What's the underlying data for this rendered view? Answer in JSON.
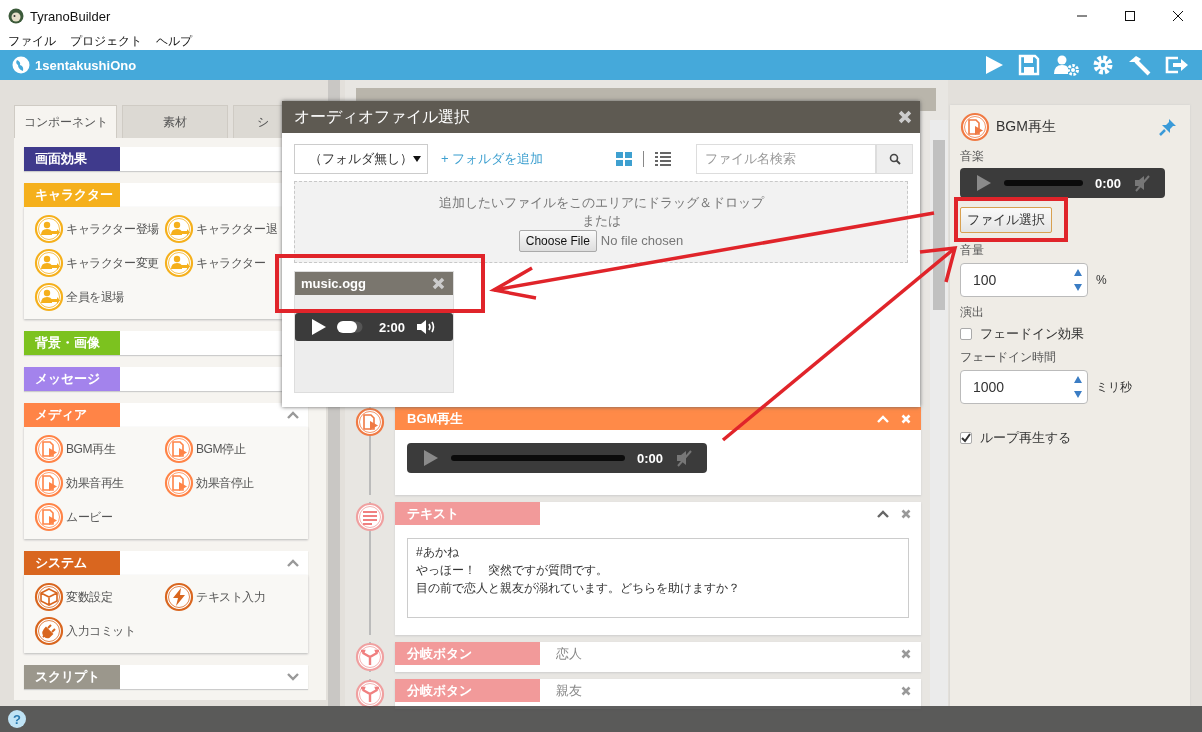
{
  "window": {
    "title": "TyranoBuilder"
  },
  "menu": [
    "ファイル",
    "プロジェクト",
    "ヘルプ"
  ],
  "toolbar": {
    "project": "1sentakushiOno"
  },
  "library": {
    "tabs": [
      {
        "label": "コンポーネント",
        "selected": true
      },
      {
        "label": "素材",
        "selected": false
      },
      {
        "label": "シ",
        "selected": false
      }
    ],
    "categories": [
      {
        "label": "画面効果",
        "color": "#3f3a8c"
      },
      {
        "kind": "character",
        "label": "キャラクター",
        "color": "#f5b01c",
        "items": [
          "キャラクター登場",
          "キャラクター退",
          "キャラクター変更",
          "キャラクター",
          "全員を退場"
        ]
      },
      {
        "label": "背景・画像",
        "color": "#7cc21f"
      },
      {
        "label": "メッセージ",
        "color": "#a383ec"
      },
      {
        "kind": "media",
        "label": "メディア",
        "color": "#ff8447",
        "expanded": true,
        "items": [
          "BGM再生",
          "BGM停止",
          "効果音再生",
          "効果音停止",
          "ムービー"
        ]
      },
      {
        "kind": "system",
        "label": "システム",
        "color": "#d9661f",
        "expanded": true,
        "items": [
          "変数設定",
          "テキスト入力",
          "入力コミット"
        ]
      },
      {
        "label": "スクリプト",
        "color": "#9b978c",
        "expanded": false
      }
    ]
  },
  "scene": {
    "items": [
      {
        "kind": "bgm",
        "label": "BGM再生",
        "color": "#ff8a48",
        "expanded": true,
        "time": "0:00"
      },
      {
        "kind": "text",
        "label": "テキスト",
        "color": "#f29a9a",
        "expanded": true,
        "lines": [
          "#あかね",
          "やっほー！　突然ですが質問です。",
          "目の前で恋人と親友が溺れています。どちらを助けますか？"
        ]
      },
      {
        "kind": "button",
        "label": "分岐ボタン",
        "color": "#f29a9a",
        "value": "恋人"
      },
      {
        "kind": "button",
        "label": "分岐ボタン",
        "color": "#f29a9a",
        "value": "親友"
      }
    ]
  },
  "dialog": {
    "title": "オーディオファイル選択",
    "folder": "（フォルダ無し）",
    "add_folder": "+ フォルダを追加",
    "view": [
      {
        "kind": "grid",
        "selected": true
      },
      {
        "kind": "list",
        "selected": false
      }
    ],
    "search": {
      "placeholder": "ファイル名検索"
    },
    "drop_text": "追加したいファイルをこのエリアにドラッグ＆ドロップ",
    "or": "または",
    "choose_button": "Choose File",
    "no_file": "No file chosen",
    "files": [
      {
        "name": "music.ogg",
        "duration": "2:00"
      }
    ]
  },
  "properties": {
    "title": "BGM再生",
    "music_label": "音楽",
    "time": "0:00",
    "file_button": "ファイル選択",
    "volume": {
      "label": "音量",
      "value": "100",
      "unit": "%"
    },
    "effect_label": "演出",
    "fade_in": {
      "label": "フェードイン効果",
      "checked": false
    },
    "fade_time": {
      "label": "フェードイン時間",
      "value": "1000",
      "unit": "ミリ秒"
    },
    "loop": {
      "label": "ループ再生する",
      "checked": true
    }
  },
  "annotations": [
    {
      "kind": "box"
    },
    {
      "kind": "box"
    },
    {
      "kind": "arrow"
    },
    {
      "kind": "arrow"
    }
  ],
  "footer": {
    "help": "?"
  }
}
